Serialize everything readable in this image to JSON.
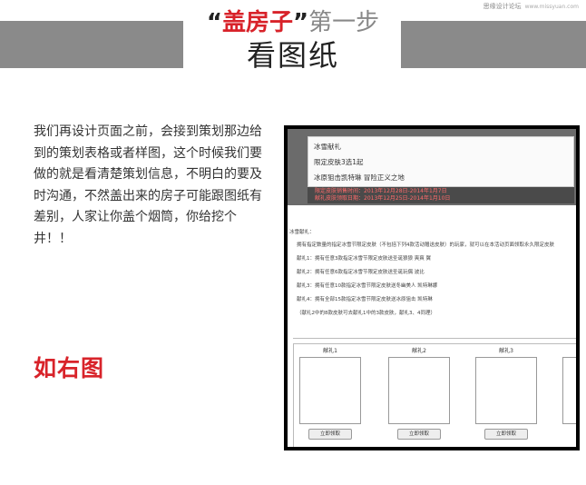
{
  "watermark": {
    "site_cn": "思缘设计论坛",
    "site_en": "www.missyuan.com"
  },
  "header": {
    "quote_open": "“",
    "highlight": "盖房子",
    "quote_close": "”",
    "step": "第一步",
    "subtitle": "看图纸"
  },
  "body_text": "我们再设计页面之前，会接到策划那边给到的策划表格或者样图，这个时候我们要做的就是看清楚策划信息，不明白的要及时沟通，不然盖出来的房子可能跟图纸有差别，人家让你盖个烟筒，你给挖个井！！",
  "highlight_text": "如右图",
  "mockup": {
    "banner_lines": [
      "冰雪献礼",
      "限定皮肤3选1起",
      "冰原狙击凯特琳 冒险正义之地"
    ],
    "red_lines": [
      "限定皮肤销售时间：2013年12月28日-2014年1月7日",
      "献礼皮肤领取日期：2013年12月25日-2014年1月10日"
    ],
    "rules_title": "冰雪献礼：",
    "rules": [
      "拥有指定数量的指定冰雪节限定皮肤（不包括下列4款活动赠送皮肤）的玩家，就可以在本活动页面领取永久限定皮肤",
      "献礼1：拥有任意3款指定冰雪节限定皮肤送圣诞狼狼 爽爽 翼",
      "献礼2：拥有任意6款指定冰雪节限定皮肤送圣诞玩偶 波比",
      "献礼3：拥有任意10款指定冰雪节限定皮肤送冬幽美人 凯特琳娜",
      "献礼4：拥有全部15款指定冰雪节限定皮肤送冰原狙击 凯特琳",
      "（献礼2中的8款皮肤可去献礼1中的3款皮肤，献礼3、4同理）"
    ],
    "gifts": [
      {
        "label": "献礼1",
        "button": "立即领取"
      },
      {
        "label": "献礼2",
        "button": "立即领取"
      },
      {
        "label": "献礼3",
        "button": "立即领取"
      }
    ]
  }
}
